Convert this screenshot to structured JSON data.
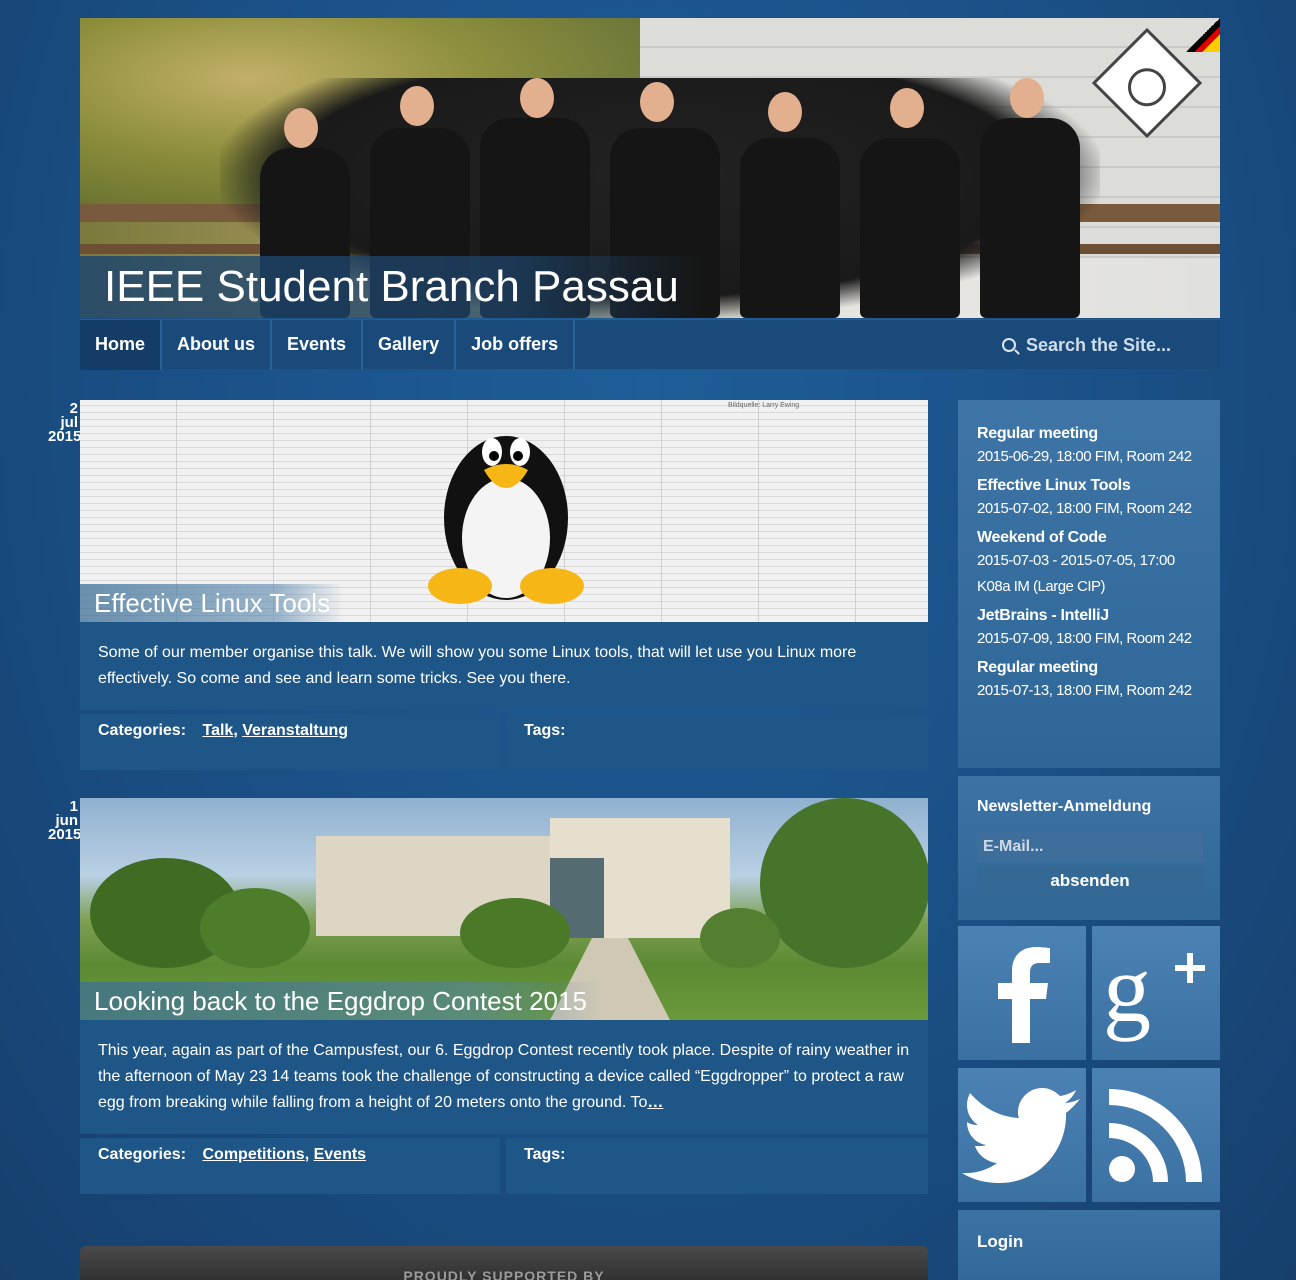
{
  "header": {
    "site_title": "IEEE Student Branch Passau"
  },
  "nav": {
    "items": [
      {
        "label": "Home",
        "active": true
      },
      {
        "label": "About us"
      },
      {
        "label": "Events"
      },
      {
        "label": "Gallery"
      },
      {
        "label": "Job offers"
      }
    ],
    "search_placeholder": "Search the Site..."
  },
  "posts": [
    {
      "date": {
        "day": "2",
        "month": "jul",
        "year": "2015"
      },
      "title": "Effective Linux Tools",
      "image_credit": "Bildquelle: Larry Ewing",
      "body": "Some of our member organise this talk. We will show you some Linux tools, that will let use you Linux more effectively. So come and see and learn some tricks. See you there.",
      "categories_label": "Categories:",
      "categories": [
        "Talk",
        "Veranstaltung"
      ],
      "tags_label": "Tags:"
    },
    {
      "date": {
        "day": "1",
        "month": "jun",
        "year": "2015"
      },
      "title": "Looking back to the Eggdrop Contest 2015",
      "body": "This year, again as part of the Campusfest, our 6. Eggdrop Contest recently took place. Despite of rainy weather in the afternoon of May 23 14 teams took the challenge of constructing a device called “Eggdropper” to protect a raw egg from breaking while falling from a height of 20 meters onto the ground. To",
      "read_more": "…",
      "categories_label": "Categories:",
      "categories": [
        "Competitions",
        "Events"
      ],
      "tags_label": "Tags:"
    }
  ],
  "sidebar": {
    "events": [
      {
        "title": "Regular meeting",
        "date": "2015-06-29, 18:00 FIM, Room 242"
      },
      {
        "title": "Effective Linux Tools",
        "date": "2015-07-02, 18:00 FIM, Room 242"
      },
      {
        "title": "Weekend of Code",
        "date": "2015-07-03 - 2015-07-05, 17:00",
        "date2": "K08a IM (Large CIP)"
      },
      {
        "title": "JetBrains - IntelliJ",
        "date": "2015-07-09, 18:00 FIM, Room 242"
      },
      {
        "title": "Regular meeting",
        "date": "2015-07-13, 18:00 FIM, Room 242"
      }
    ],
    "newsletter": {
      "title": "Newsletter-Anmeldung",
      "email_placeholder": "E-Mail...",
      "submit_label": "absenden"
    },
    "social": [
      "facebook-icon",
      "google-plus-icon",
      "twitter-icon",
      "rss-icon"
    ],
    "login_title": "Login"
  },
  "footer": {
    "text": "PROUDLY SUPPORTED BY"
  },
  "colors": {
    "background": "#1b5186",
    "panel": "#1f5688",
    "sidebar": "#3e75a6"
  }
}
